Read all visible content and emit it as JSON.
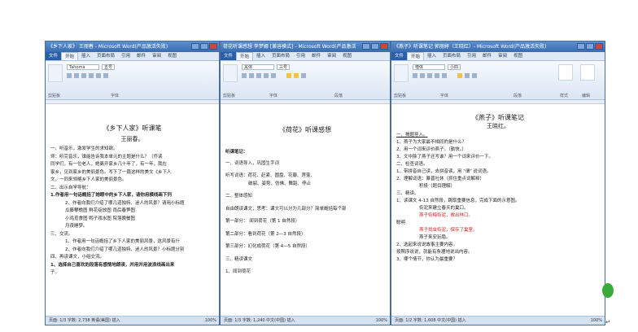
{
  "windows": [
    {
      "title": "《乡下人家》 王丽春 - Microsoft Word(产品激活失败)",
      "tabs": [
        "文件",
        "开始",
        "插入",
        "页面布局",
        "引用",
        "邮件",
        "审阅",
        "视图"
      ],
      "font": "Tahoma",
      "size": "五号",
      "groups": [
        "剪贴板",
        "字体"
      ],
      "doc_title": "《乡下人家》听课笔",
      "doc_author": "王丽春。",
      "lines": [
        "一、听音乐，激发学生的求知欲。",
        "师：听完音乐，谁能告诉我本单元的主题是什么？（乔读",
        "同学们，有一位老人，她离开家乡几十年了，有一年，我在",
        "家乡，见到家乡的美丽景色。写下了一篇这样的美文《乡下人",
        "文，一同来领略乡下人家的美丽景色。",
        "二、出示自学导航：",
        "1.作者用一句话概括了她眼中的乡下人家，请你用横线画下列",
        "2、作者向我们介绍了哪几道独特、迷人的风景？请用小标题",
        "瓜藤攀檐图  鲜花绽放图  雨后春笋图",
        "小鸡觅食图  鸭子戏水图  院落晚餐图",
        "月夜睡梦。",
        "三、交流。",
        "1、作者用一句话概括了乡下人家的美丽风景，这风景有什",
        "2、作者向我们介绍了哪几道独特、迷人的风景？小标题分别",
        "四、再读课文，小组交流。",
        "1、选择自己喜欢的段落有感情地朗读，并用并用波浪线画出来",
        "子。"
      ],
      "status": "页面: 1/3  字数: 2,738  英语(美国)  插入",
      "zoom": "100%"
    },
    {
      "title": "荷花听课感想 李梦娜 [兼容模式] - Microsoft Word(产品激活",
      "tabs": [
        "文件",
        "开始",
        "插入",
        "页面布局",
        "引用",
        "邮件",
        "审阅",
        "视图"
      ],
      "font": "黑体",
      "size": "三号",
      "groups": [
        "剪贴板",
        "字体",
        "段落"
      ],
      "doc_title": "《荷花》听课感想",
      "lines": [
        "听课笔记：",
        "一、词语导入，巩固生字词",
        "听写词语：荷花、赶紧、圆盘、花瓣、莲蓬、",
        "破裂、姿势、仿佛、舞蹈、停止",
        "二、整体感知",
        "自由朗读课文，思考：课文可以分为几部分？简单概括每个部",
        "第一部分：  闻到荷花（第 1 自然段）",
        "第二部分：看到荷花（第 2—3 自然段）",
        "第三部分：幻化成荷花（第 4—5 自然段）",
        "三、精读课文",
        "1、闻到荷花"
      ],
      "status": "页面: 1/3  字数: 1,240  中文(中国)  插入",
      "zoom": "100%"
    },
    {
      "title": "《燕子》听课笔记 郭丽婷（王晓红）- Microsoft Word(产品激活失败)",
      "tabs": [
        "文件",
        "开始",
        "插入",
        "页面布局",
        "引用",
        "邮件",
        "审阅",
        "视图"
      ],
      "font": "楷体",
      "size": "小四",
      "groups": [
        "剪贴板",
        "字体",
        "段落",
        "样式",
        "编辑"
      ],
      "doc_title": "《燕子》听课笔记",
      "doc_author": "王晓红。",
      "lines": [
        "一、揭题导入。",
        "1、燕子为大家最不相同的是什么？",
        "2、用一个词来评价燕子。（勤快。）",
        "3、文中除了燕子还写谁？用一个词来评价一下。",
        "二、检查词语。",
        "1、带拼音自己读，去拼音读，用 \"谓\" 说词语。",
        "2、理解词语：暴晋吐休（抓住重点词解释）",
        "积极（题目理解）",
        "三、精读。",
        "1、读课文 4-13 自然段，跳取重要信息，完成下面的示意图。",
        "衔泥来建立春天的巢口。",
        "燕子衔梅衔泥，救出林口。",
        "聪明",
        "燕子找虫衔泥，保存了巢室。",
        "燕子来安玩隐。",
        "2、选起来说说故事主要内容。",
        "按照序说说，就能有条理地说出内容。",
        "3、哪个情节，你认为最重要？"
      ],
      "red_lines": [
        11,
        13
      ],
      "status": "页面: 1/2  字数: 1,608  中文(中国)  插入",
      "zoom": "100%"
    }
  ]
}
